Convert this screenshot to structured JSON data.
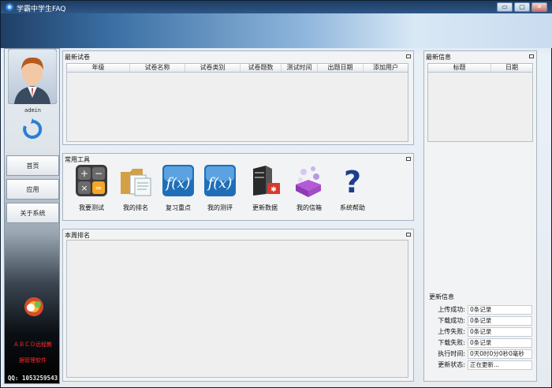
{
  "window": {
    "title": "学霸中学生FAQ",
    "controls": {
      "minimize": "▭",
      "maximize": "▢",
      "close": "✕"
    }
  },
  "sidebar": {
    "username": "admin",
    "nav": [
      "首页",
      "应用",
      "关于系统"
    ],
    "promo_line1": "ＡＢＣＤ远程教",
    "promo_line2": "据管理软件",
    "qq": "QQ: 1053259543"
  },
  "latest_papers": {
    "title": "最新试卷",
    "columns": [
      "年级",
      "试卷名称",
      "试卷类别",
      "试卷题数",
      "测试时间",
      "出题日期",
      "添加用户"
    ],
    "rows": []
  },
  "tools": {
    "title": "常用工具",
    "items": [
      {
        "label": "我要测试",
        "icon": "calculator-icon"
      },
      {
        "label": "我的排名",
        "icon": "folder-documents-icon"
      },
      {
        "label": "复习重点",
        "icon": "function-fx-icon"
      },
      {
        "label": "我的测评",
        "icon": "function-fx-icon"
      },
      {
        "label": "更新数据",
        "icon": "server-update-icon"
      },
      {
        "label": "我的信箱",
        "icon": "molecule-mailbox-icon"
      },
      {
        "label": "系统帮助",
        "icon": "question-mark-icon"
      }
    ]
  },
  "weekly_rank": {
    "title": "本周排名"
  },
  "latest_info": {
    "title": "最新信息",
    "columns": [
      "标题",
      "日期"
    ],
    "rows": []
  },
  "update_info": {
    "title": "更新信息",
    "rows": [
      {
        "label": "上传成功:",
        "value": "0条记录"
      },
      {
        "label": "下载成功:",
        "value": "0条记录"
      },
      {
        "label": "上传失败:",
        "value": "0条记录"
      },
      {
        "label": "下载失败:",
        "value": "0条记录"
      },
      {
        "label": "执行时间:",
        "value": "0天0时0分0秒0毫秒"
      },
      {
        "label": "更新状态:",
        "value": "正在更新..."
      }
    ]
  }
}
